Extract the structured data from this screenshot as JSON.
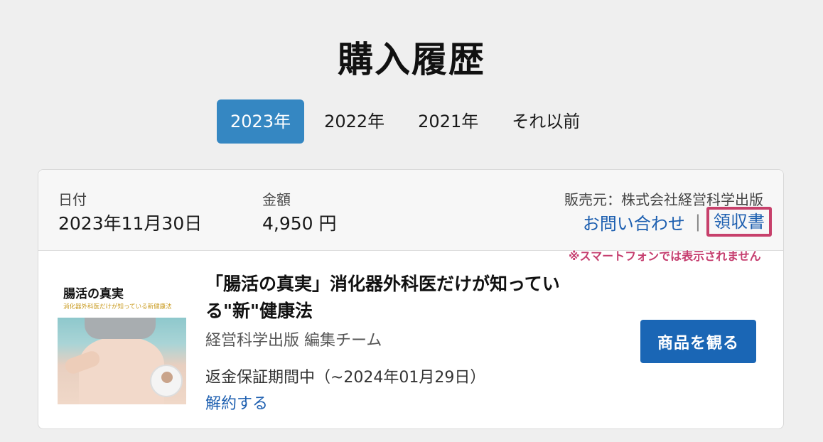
{
  "page": {
    "title": "購入履歴"
  },
  "year_tabs": [
    {
      "label": "2023年",
      "active": true
    },
    {
      "label": "2022年",
      "active": false
    },
    {
      "label": "2021年",
      "active": false
    },
    {
      "label": "それ以前",
      "active": false
    }
  ],
  "order": {
    "date_label": "日付",
    "date_value": "2023年11月30日",
    "amount_label": "金額",
    "amount_value": "4,950 円",
    "seller": "販売元：株式会社経営科学出版",
    "contact_link": "お問い合わせ",
    "separator": "|",
    "receipt_link": "領収書",
    "note": "※スマートフォンでは表示されません"
  },
  "product": {
    "thumb_title": "腸活の真実",
    "thumb_subtitle": "消化器外科医だけが知っている新健康法",
    "title": "「腸活の真実」消化器外科医だけが知っている\"新\"健康法",
    "author": "経営科学出版 編集チーム",
    "refund_status": "返金保証期間中（~2024年01月29日）",
    "cancel_link": "解約する",
    "view_button": "商品を観る"
  },
  "colors": {
    "accent": "#3587c2",
    "button": "#1a66b5",
    "link": "#1d5fb0",
    "highlight": "#c7406b"
  }
}
